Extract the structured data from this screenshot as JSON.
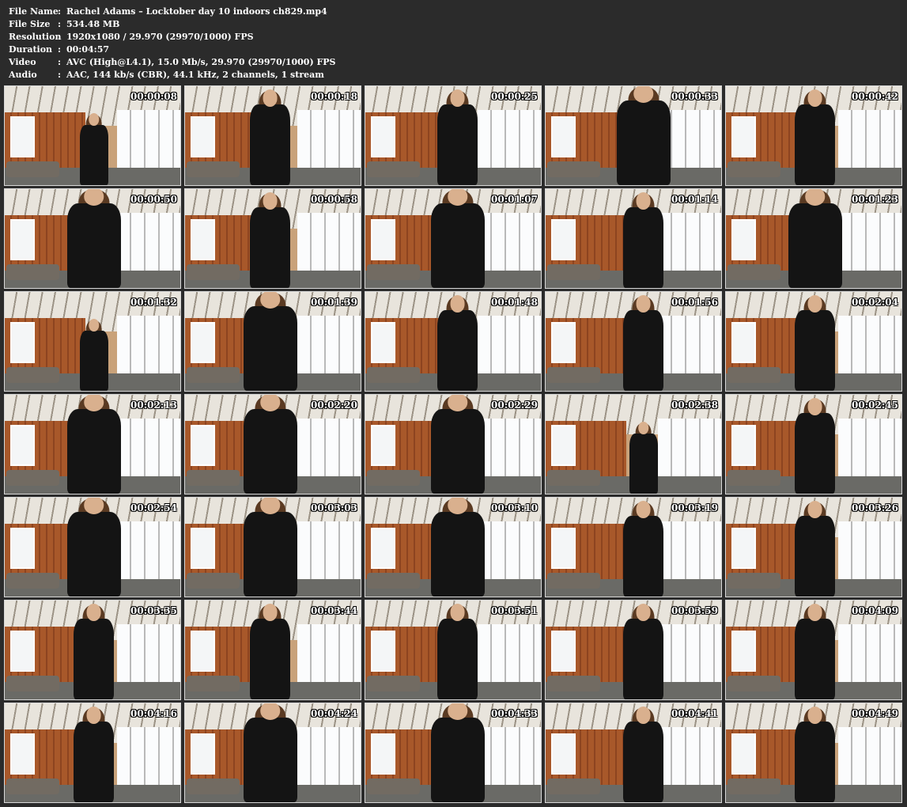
{
  "file_info": [
    {
      "key": "File Name",
      "value": "Rachel Adams – Locktober day 10 indoors ch829.mp4"
    },
    {
      "key": "File Size",
      "value": "534.48 MB"
    },
    {
      "key": "Resolution",
      "value": "1920x1080 / 29.970 (29970/1000) FPS"
    },
    {
      "key": "Duration",
      "value": "00:04:57"
    },
    {
      "key": "Video",
      "value": "AVC (High@L4.1), 15.0 Mb/s, 29.970 (29970/1000) FPS"
    },
    {
      "key": "Audio",
      "value": "AAC, 144 kb/s (CBR), 44.1 kHz, 2 channels, 1 stream"
    }
  ],
  "separator": ":",
  "thumbnails": [
    {
      "timestamp": "00:00:08",
      "figure": "far"
    },
    {
      "timestamp": "00:00:18",
      "figure": "mid"
    },
    {
      "timestamp": "00:00:25",
      "figure": "mid"
    },
    {
      "timestamp": "00:00:33",
      "figure": "close"
    },
    {
      "timestamp": "00:00:42",
      "figure": "mid"
    },
    {
      "timestamp": "00:00:50",
      "figure": "close"
    },
    {
      "timestamp": "00:00:58",
      "figure": "mid"
    },
    {
      "timestamp": "00:01:07",
      "figure": "close"
    },
    {
      "timestamp": "00:01:14",
      "figure": "mid"
    },
    {
      "timestamp": "00:01:23",
      "figure": "close"
    },
    {
      "timestamp": "00:01:32",
      "figure": "far"
    },
    {
      "timestamp": "00:01:39",
      "figure": "close"
    },
    {
      "timestamp": "00:01:48",
      "figure": "mid"
    },
    {
      "timestamp": "00:01:56",
      "figure": "mid"
    },
    {
      "timestamp": "00:02:04",
      "figure": "mid"
    },
    {
      "timestamp": "00:02:13",
      "figure": "close"
    },
    {
      "timestamp": "00:02:20",
      "figure": "close"
    },
    {
      "timestamp": "00:02:29",
      "figure": "close"
    },
    {
      "timestamp": "00:02:38",
      "figure": "far"
    },
    {
      "timestamp": "00:02:45",
      "figure": "mid"
    },
    {
      "timestamp": "00:02:54",
      "figure": "close"
    },
    {
      "timestamp": "00:03:03",
      "figure": "close"
    },
    {
      "timestamp": "00:03:10",
      "figure": "close"
    },
    {
      "timestamp": "00:03:19",
      "figure": "mid"
    },
    {
      "timestamp": "00:03:26",
      "figure": "mid"
    },
    {
      "timestamp": "00:03:35",
      "figure": "mid"
    },
    {
      "timestamp": "00:03:44",
      "figure": "mid"
    },
    {
      "timestamp": "00:03:51",
      "figure": "mid"
    },
    {
      "timestamp": "00:03:59",
      "figure": "mid"
    },
    {
      "timestamp": "00:04:09",
      "figure": "mid"
    },
    {
      "timestamp": "00:04:16",
      "figure": "mid"
    },
    {
      "timestamp": "00:04:24",
      "figure": "close"
    },
    {
      "timestamp": "00:04:33",
      "figure": "close"
    },
    {
      "timestamp": "00:04:41",
      "figure": "mid"
    },
    {
      "timestamp": "00:04:49",
      "figure": "mid"
    }
  ],
  "colors": {
    "background": "#2b2b2b",
    "text": "#ffffff",
    "thumb_border": "#d8d8d8"
  }
}
